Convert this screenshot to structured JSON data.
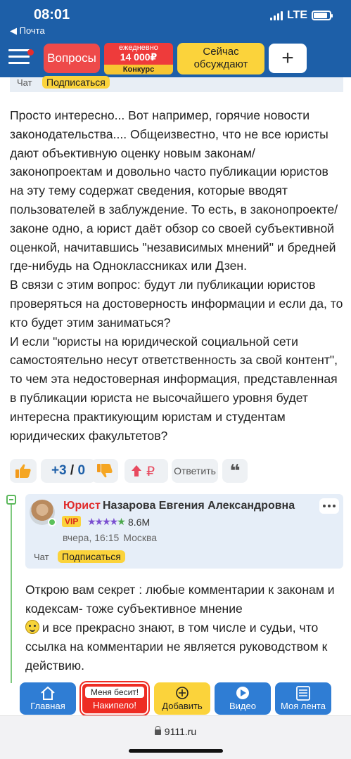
{
  "status_bar": {
    "time": "08:01",
    "back_label": "◀ Почта",
    "network": "LTE",
    "battery_level": 0.85
  },
  "header": {
    "questions_label": "Вопросы",
    "contest_top": "ежедневно",
    "contest_amount": "14 000₽",
    "contest_label": "Конкурс",
    "discuss_line1": "Сейчас",
    "discuss_line2": "обсуждают",
    "plus_label": "+"
  },
  "question_meta": {
    "chat_label": "Чат",
    "subscribe_label": "Подписаться"
  },
  "question": {
    "paragraphs": [
      "Просто интересно... Вот например, горячие новости законодательства.... Общеизвестно, что не все юристы дают объективную оценку новым законам/законопроектам и довольно часто публикации юристов на эту тему содержат сведения, которые вводят пользователей в заблуждение. То есть, в законопроекте/законе одно, а юрист даёт обзор со своей субъективной оценкой, начитавшись \"независимых мнений\" и бредней где-нибудь на Одноклассниках или Дзен.",
      "В связи с этим вопрос: будут ли публикации юристов проверяться на достоверность информации и если да, то кто будет этим заниматься?",
      "И если \"юристы на юридической социальной сети самостоятельно несут ответственность за свой контент\", то чем эта недостоверная информация, представленная в публикации юриста не высочайшего уровня будет интересна практикующим юристам и студентам юридических факультетов?"
    ]
  },
  "votes": {
    "plus": "+3",
    "separator": "/",
    "minus": "0",
    "reply_label": "Ответить",
    "quote_glyph": "❝"
  },
  "comment": {
    "role": "Юрист",
    "author": "Назарова Евгения Александровна",
    "vip": "VIP",
    "stars": "★★★★",
    "half_star": "★",
    "rating": "8.6M",
    "time": "вчера, 16:15",
    "city": "Москва",
    "chat_label": "Чат",
    "subscribe_label": "Подписаться",
    "text_before": "Открою вам секрет : любые комментарии к законам и кодексам- тоже субъективное мнение",
    "text_after": "и все прекрасно знают, в том числе и судьи, что ссылка на комментарии не является руководством к действию."
  },
  "bottom_nav": {
    "home": "Главная",
    "annoy_top": "Меня бесит!",
    "annoy_bottom": "Накипело!",
    "add": "Добавить",
    "video": "Видео",
    "feed": "Моя лента"
  },
  "browser": {
    "url": "9111.ru"
  },
  "colors": {
    "brand_blue": "#1d5fa8",
    "accent_yellow": "#fbd33b",
    "accent_red": "#ee4a4a",
    "nav_blue": "#2f7dd4"
  }
}
